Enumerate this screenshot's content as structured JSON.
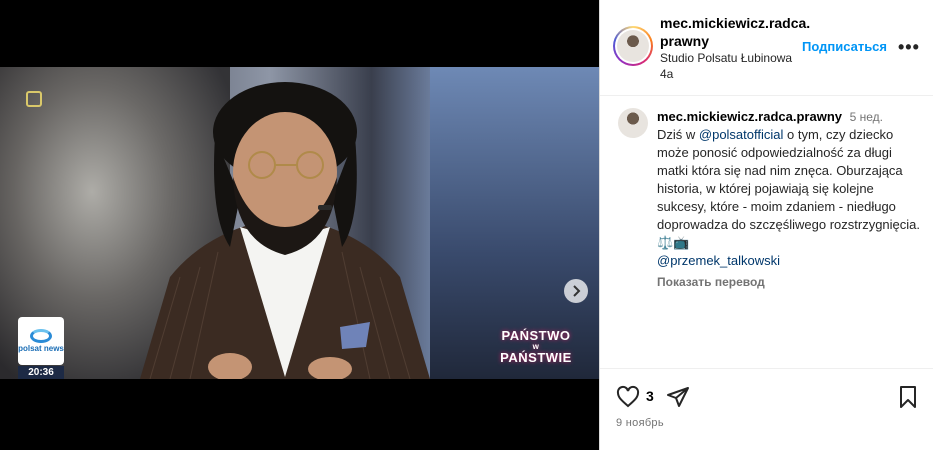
{
  "post": {
    "username": "mec.mickiewicz.radca.prawny",
    "username_line1": "mec.mickiewicz.radca.",
    "username_line2": "prawny",
    "location_line1": "Studio Polsatu Łubinowa",
    "location_line2": "4a",
    "follow_label": "Подписаться",
    "more_label": "•••"
  },
  "media": {
    "news_logo_text": "polsat news",
    "clock": "20:36",
    "show_title_1": "PAŃSTWO",
    "show_title_w": "w",
    "show_title_2": "PAŃSTWIE",
    "slides_total": 2,
    "slide_current": 1
  },
  "caption": {
    "username": "mec.mickiewicz.radca.prawny",
    "time": "5 нед.",
    "text_prefix": "Dziś w ",
    "mention1": "@polsatofficial",
    "text_body": " o tym, czy dziecko może ponosić odpowiedzialność za długi matki która się nad nim znęca. Oburzająca historia, w której pojawiają się kolejne sukcesy, które - moim zdaniem - niedługo doprowadza do szczęśliwego rozstrzygnięcia. ",
    "emojis": "⚖️📺",
    "mention2": "@przemek_talkowski",
    "translate_label": "Показать перевод"
  },
  "actions": {
    "likes": "3",
    "date": "9 ноябрь"
  },
  "colors": {
    "accent": "#0095f6",
    "mention": "#00376b",
    "secondary_text": "#737373"
  }
}
